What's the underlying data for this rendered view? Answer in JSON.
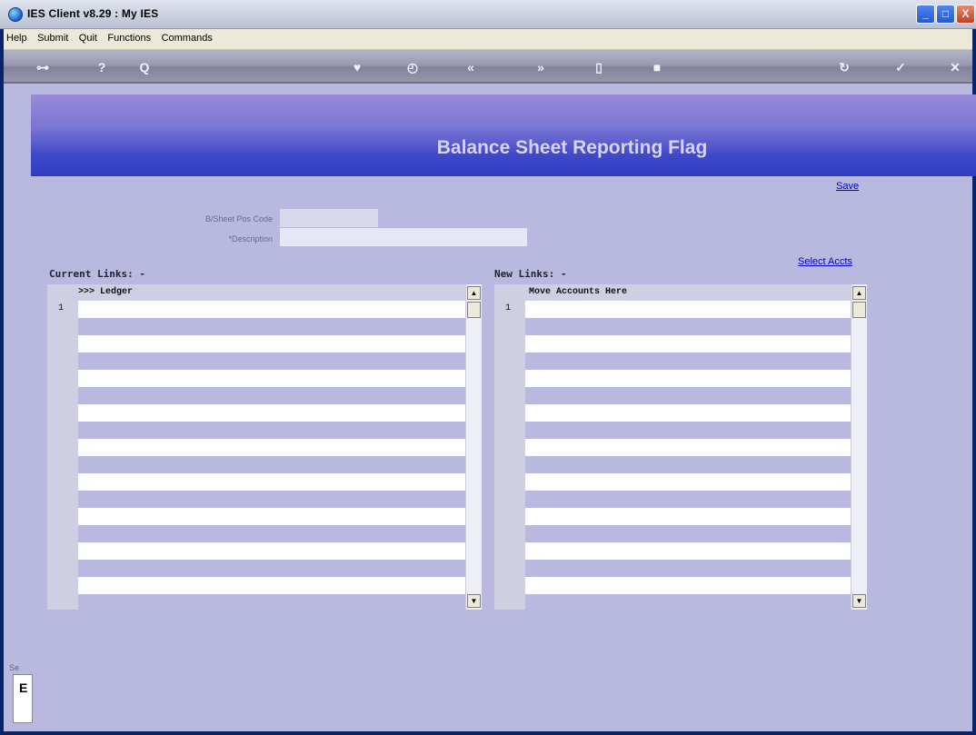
{
  "window": {
    "title": "IES Client v8.29 : My IES",
    "min_label": "_",
    "max_label": "□",
    "close_label": "X"
  },
  "menu": [
    "Help",
    "Submit",
    "Quit",
    "Functions",
    "Commands"
  ],
  "toolbar": {
    "back": "⊶",
    "help": "?",
    "search": "Q",
    "heart": "♥",
    "clock": "◴",
    "prev": "«",
    "next": "»",
    "doc": "▯",
    "stop": "■",
    "refresh": "↻",
    "ok": "✓",
    "close": "✕"
  },
  "page": {
    "title": "Balance Sheet Reporting Flag",
    "save_link": "Save",
    "select_accts_link": "Select Accts"
  },
  "form": {
    "code_label": "B/Sheet Pos Code",
    "code_value": "",
    "description_label": "*Description",
    "description_value": ""
  },
  "current_links": {
    "label": "Current Links: -",
    "header": ">>> Ledger",
    "first_row_number": "1"
  },
  "new_links": {
    "label": "New Links: -",
    "header": "Move Accounts Here",
    "first_row_number": "1"
  },
  "sidebar": {
    "label": "Se",
    "box_text": "E"
  },
  "colors": {
    "content_bg": "#b9b9e0",
    "banner_top": "#9a8ad8",
    "banner_bottom": "#2e3cc4",
    "link": "#0000cc"
  }
}
